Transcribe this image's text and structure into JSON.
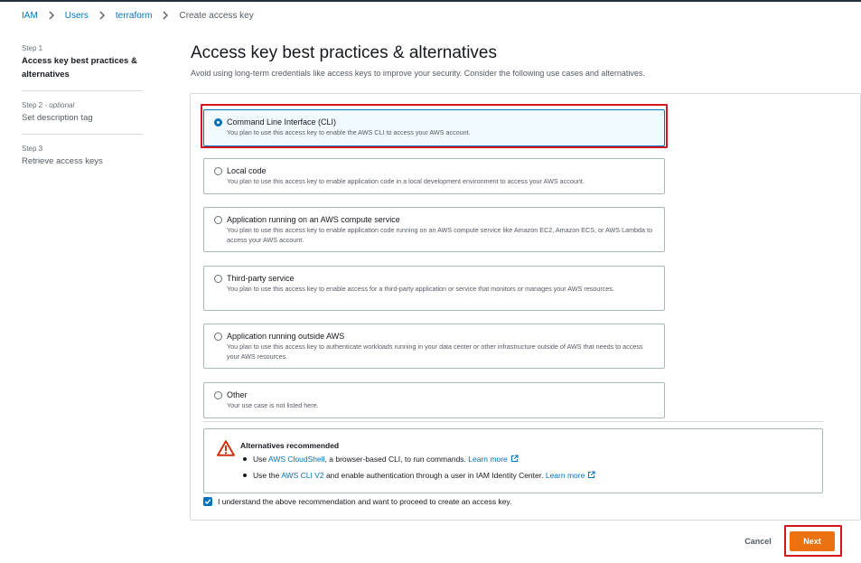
{
  "breadcrumb": {
    "items": [
      "IAM",
      "Users",
      "terraform"
    ],
    "current": "Create access key"
  },
  "steps": [
    {
      "num": "Step 1",
      "optional": "",
      "title": "Access key best practices & alternatives"
    },
    {
      "num": "Step 2",
      "optional": "optional",
      "title": "Set description tag"
    },
    {
      "num": "Step 3",
      "optional": "",
      "title": "Retrieve access keys"
    }
  ],
  "main": {
    "title": "Access key best practices & alternatives",
    "description": "Avoid using long-term credentials like access keys to improve your security. Consider the following use cases and alternatives."
  },
  "options": [
    {
      "label": "Command Line Interface (CLI)",
      "desc": "You plan to use this access key to enable the AWS CLI to access your AWS account.",
      "selected": true
    },
    {
      "label": "Local code",
      "desc": "You plan to use this access key to enable application code in a local development environment to access your AWS account.",
      "selected": false
    },
    {
      "label": "Application running on an AWS compute service",
      "desc": "You plan to use this access key to enable application code running on an AWS compute service like Amazon EC2, Amazon ECS, or AWS Lambda to access your AWS account.",
      "selected": false
    },
    {
      "label": "Third-party service",
      "desc": "You plan to use this access key to enable access for a third-party application or service that monitors or manages your AWS resources.",
      "selected": false
    },
    {
      "label": "Application running outside AWS",
      "desc": "You plan to use this access key to authenticate workloads running in your data center or other infrastructure outside of AWS that needs to access your AWS resources.",
      "selected": false
    },
    {
      "label": "Other",
      "desc": "Your use case is not listed here.",
      "selected": false
    }
  ],
  "alert": {
    "title": "Alternatives recommended",
    "item1": {
      "pre": "Use ",
      "link": "AWS CloudShell",
      "mid": ", a browser-based CLI, to run commands. ",
      "learn": "Learn more"
    },
    "item2": {
      "pre": "Use the ",
      "link": "AWS CLI V2",
      "mid": " and enable authentication through a user in IAM Identity Center. ",
      "learn": "Learn more"
    }
  },
  "ack": {
    "label": "I understand the above recommendation and want to proceed to create an access key.",
    "checked": true
  },
  "buttons": {
    "cancel": "Cancel",
    "next": "Next"
  },
  "colors": {
    "accent": "#0073bb",
    "primary_button": "#ec7211",
    "highlight": "#d6141b"
  },
  "icons": [
    "chevron-right-icon",
    "warning-icon",
    "external-link-icon",
    "check-icon"
  ]
}
